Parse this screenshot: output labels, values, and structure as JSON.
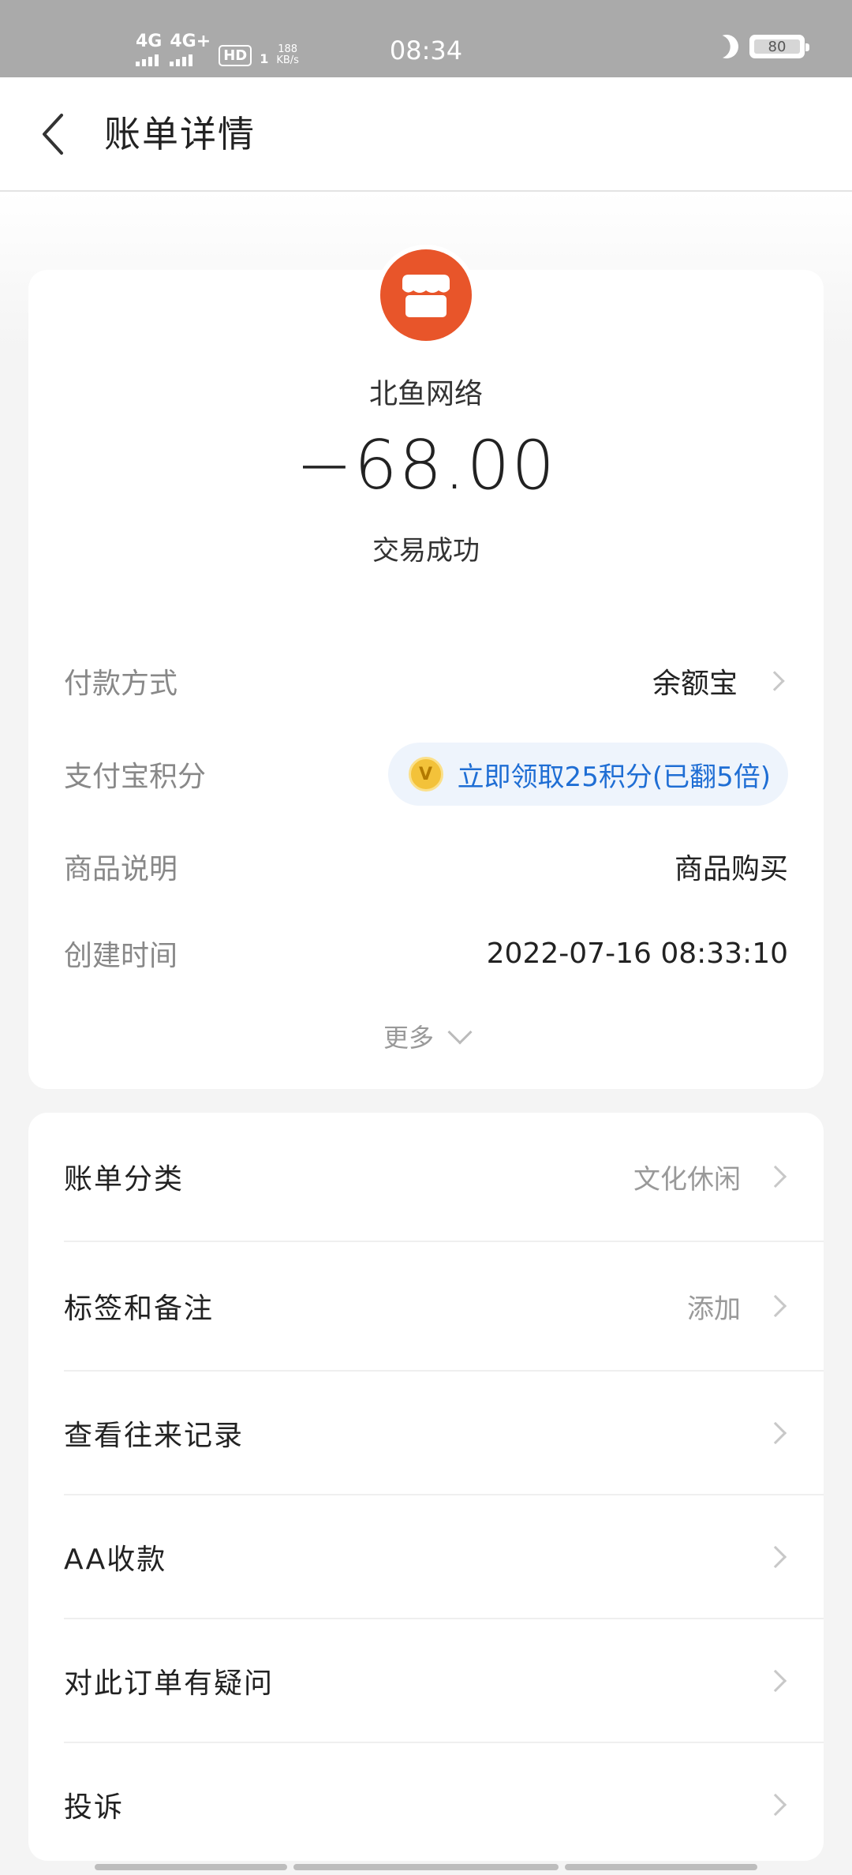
{
  "status_bar": {
    "network1": "4G",
    "network2": "4G+",
    "hd": "HD",
    "hd_sub": "1",
    "speed_value": "188",
    "speed_unit": "KB/s",
    "time": "08:34",
    "battery": "80"
  },
  "header": {
    "title": "账单详情"
  },
  "bill": {
    "merchant": "北鱼网络",
    "amount": "−68.00",
    "status": "交易成功",
    "rows": [
      {
        "label": "付款方式",
        "value": "余额宝"
      },
      {
        "label": "支付宝积分",
        "value": "立即领取25积分(已翻5倍)"
      },
      {
        "label": "商品说明",
        "value": "商品购买"
      },
      {
        "label": "创建时间",
        "value": "2022-07-16 08:33:10"
      }
    ],
    "more": "更多"
  },
  "menu": [
    {
      "label": "账单分类",
      "value": "文化休闲"
    },
    {
      "label": "标签和备注",
      "value": "添加"
    },
    {
      "label": "查看往来记录",
      "value": ""
    },
    {
      "label": "AA收款",
      "value": ""
    },
    {
      "label": "对此订单有疑问",
      "value": ""
    },
    {
      "label": "投诉",
      "value": ""
    }
  ],
  "colors": {
    "merchant_logo": "#e8552a",
    "points_text": "#1f6ed4",
    "points_bg": "#eef4fc",
    "status_bar": "#aaaaaa"
  },
  "icons": {
    "back": "chevron-left-icon",
    "merchant": "store-icon",
    "points_badge": "v-badge-icon",
    "row_arrow": "chevron-right-icon",
    "more": "chevron-down-icon"
  }
}
